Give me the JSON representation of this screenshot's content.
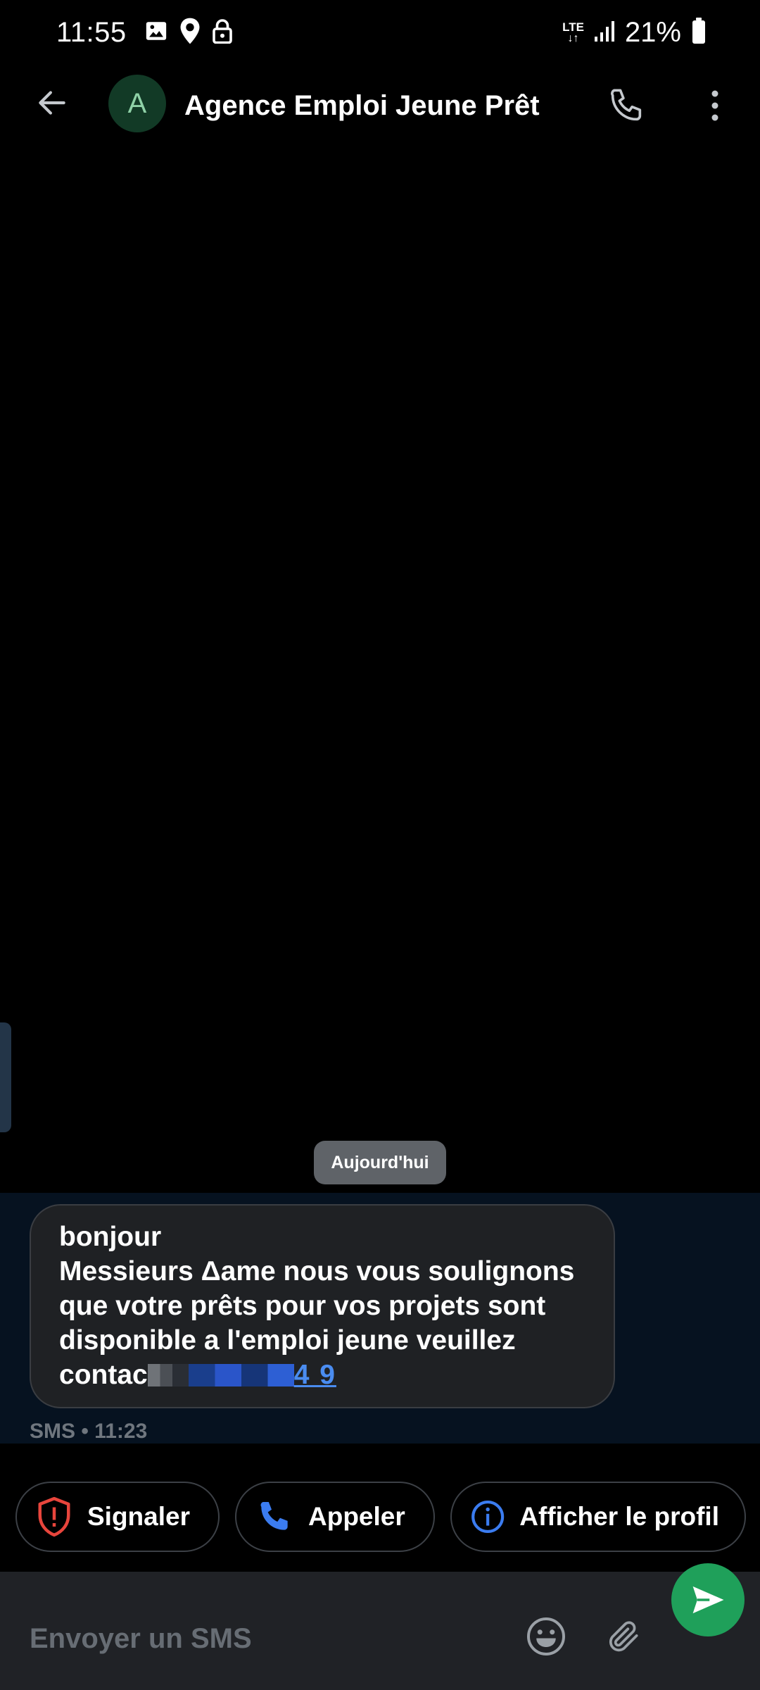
{
  "status_bar": {
    "time": "11:55",
    "network": "LTE",
    "battery_percent": "21%",
    "icons": [
      "image-icon",
      "location-icon",
      "lock-icon",
      "lte-icon",
      "signal-icon",
      "battery-icon"
    ]
  },
  "header": {
    "avatar_letter": "A",
    "title": "Agence Emploi Jeune Prêt",
    "icons": [
      "back-arrow-icon",
      "phone-icon",
      "more-vertical-icon"
    ]
  },
  "conversation": {
    "date_label": "Aujourd'hui",
    "message": {
      "line1": "bonjour",
      "line2": "Messieurs Δame nous vous soulignons",
      "line3": "que votre prêts pour vos projets sont",
      "line4": "disponible a l'emploi jeune veuillez",
      "line5_prefix": "contac",
      "line5_link": "4 9"
    },
    "meta": "SMS • 11:23"
  },
  "actions": {
    "report_label": "Signaler",
    "call_label": "Appeler",
    "profile_label": "Afficher le profil"
  },
  "compose": {
    "placeholder": "Envoyer un SMS"
  },
  "colors": {
    "background": "#000000",
    "message_area": "#061220",
    "bubble": "#1f2124",
    "link": "#4a8cf0",
    "report_red": "#e8453c",
    "call_blue": "#3b7cf0",
    "send_green": "#1fa05a",
    "avatar_bg": "#123a26"
  }
}
